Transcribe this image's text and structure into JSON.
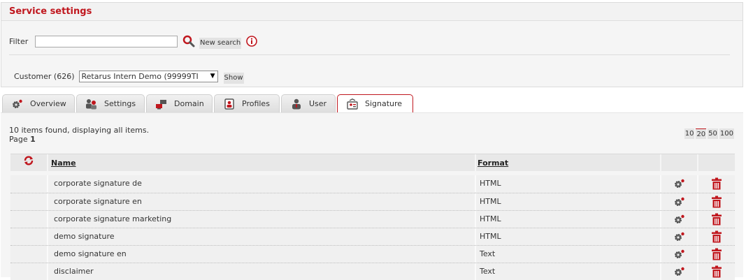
{
  "panel": {
    "title": "Service settings",
    "filter_label": "Filter",
    "filter_value": "",
    "new_search_label": "New search",
    "customer_label": "Customer (626)",
    "customer_selected": "Retarus Intern Demo (99999TI",
    "show_label": "Show"
  },
  "tabs": [
    {
      "label": "Overview",
      "icon": "gear-icon"
    },
    {
      "label": "Settings",
      "icon": "users-icon"
    },
    {
      "label": "Domain",
      "icon": "network-icon"
    },
    {
      "label": "Profiles",
      "icon": "profile-card-icon"
    },
    {
      "label": "User",
      "icon": "user-icon"
    },
    {
      "label": "Signature",
      "icon": "signature-icon",
      "active": true
    }
  ],
  "list": {
    "items_info": "10 items found, displaying all items.",
    "page_label": "Page",
    "page_number": "1",
    "page_sizes": [
      "10",
      "20",
      "50",
      "100"
    ],
    "selected_page_size": "20",
    "columns": {
      "name": "Name",
      "format": "Format"
    },
    "rows": [
      {
        "name": "corporate signature de",
        "format": "HTML"
      },
      {
        "name": "corporate signature en",
        "format": "HTML"
      },
      {
        "name": "corporate signature marketing",
        "format": "HTML"
      },
      {
        "name": "demo signature",
        "format": "HTML"
      },
      {
        "name": "demo signature en",
        "format": "Text"
      },
      {
        "name": "disclaimer",
        "format": "Text"
      }
    ]
  },
  "colors": {
    "accent": "#c0171e",
    "background": "#f5f5f5",
    "header": "#e8e8e8"
  }
}
